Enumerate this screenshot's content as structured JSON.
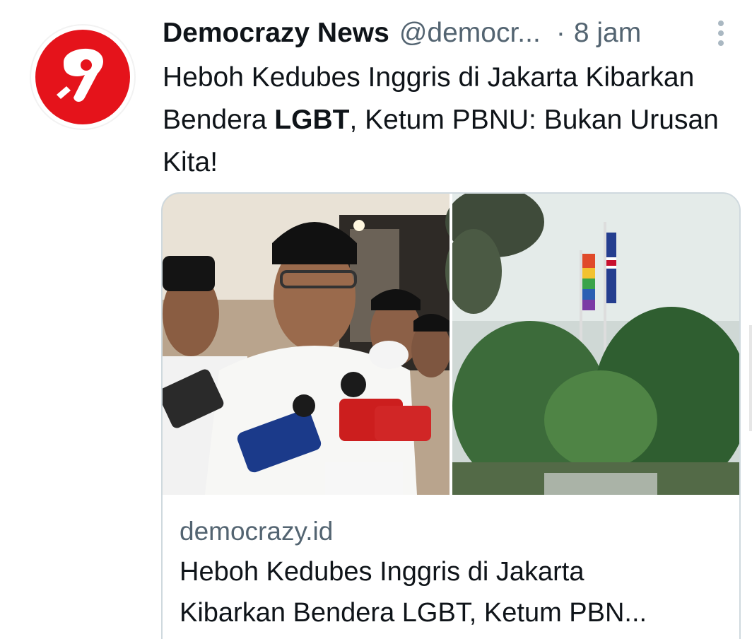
{
  "tweet": {
    "author_name": "Democrazy News",
    "handle": "@democr...",
    "separator": "·",
    "time": "8 jam",
    "text_part1": "Heboh Kedubes Inggris di Jakarta Kibarkan Bendera ",
    "text_bold": "LGBT",
    "text_part2": ", Ketum PBNU: Bukan Urusan Kita!"
  },
  "card": {
    "domain": "democrazy.id",
    "title_line1": "Heboh Kedubes Inggris di Jakarta",
    "title_line2": "Kibarkan Bendera LGBT, Ketum PBN..."
  },
  "icons": {
    "avatar": "democrazy-logo-icon",
    "more": "more-vertical-icon"
  },
  "colors": {
    "brand_red": "#e5131b",
    "secondary_text": "#536471",
    "border": "#cfd9de"
  }
}
